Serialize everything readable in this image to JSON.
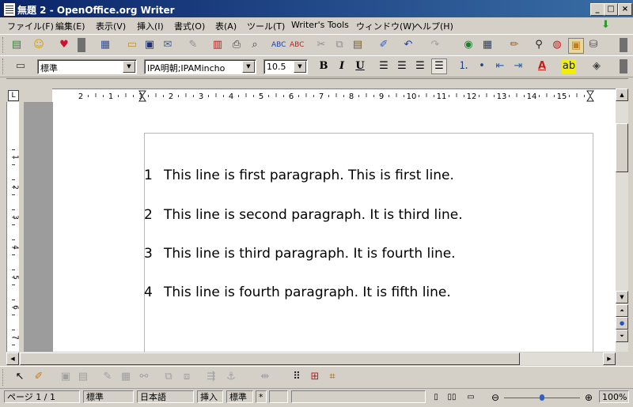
{
  "window": {
    "title": "無題 2 - OpenOffice.org Writer",
    "minimize": "_",
    "restore": "□",
    "close": "×"
  },
  "menu": [
    "ファイル(F)",
    "編集(E)",
    "表示(V)",
    "挿入(I)",
    "書式(O)",
    "表(A)",
    "ツール(T)",
    "Writer's Tools",
    "ウィンドウ(W)",
    "ヘルプ(H)"
  ],
  "formatting": {
    "paragraph_style": "標準",
    "font_name": "IPA明朝;IPAMincho",
    "font_size": "10.5",
    "bold": "B",
    "italic": "I",
    "underline": "U"
  },
  "ruler": {
    "marks": [
      "2",
      "1",
      "1",
      "2",
      "3",
      "4",
      "5",
      "6",
      "7",
      "8",
      "9",
      "10",
      "11",
      "12",
      "13",
      "14",
      "15"
    ]
  },
  "document": {
    "lines": [
      {
        "num": "1",
        "text": "This line is first paragraph. This is first line."
      },
      {
        "num": "2",
        "text": "This line is second paragraph. It is third line."
      },
      {
        "num": "3",
        "text": "This line is third  paragraph. It is fourth line."
      },
      {
        "num": "4",
        "text": "This line is fourth  paragraph. It is fifth line."
      }
    ]
  },
  "vruler": {
    "marks": [
      "1",
      "2",
      "3",
      "4",
      "5",
      "6",
      "7"
    ]
  },
  "status": {
    "page": "ページ 1 / 1",
    "style": "標準",
    "language": "日本語",
    "insert_mode": "挿入",
    "selection_mode": "標準",
    "modified": "*",
    "zoom": "100%",
    "zoom_level": 0.5
  }
}
